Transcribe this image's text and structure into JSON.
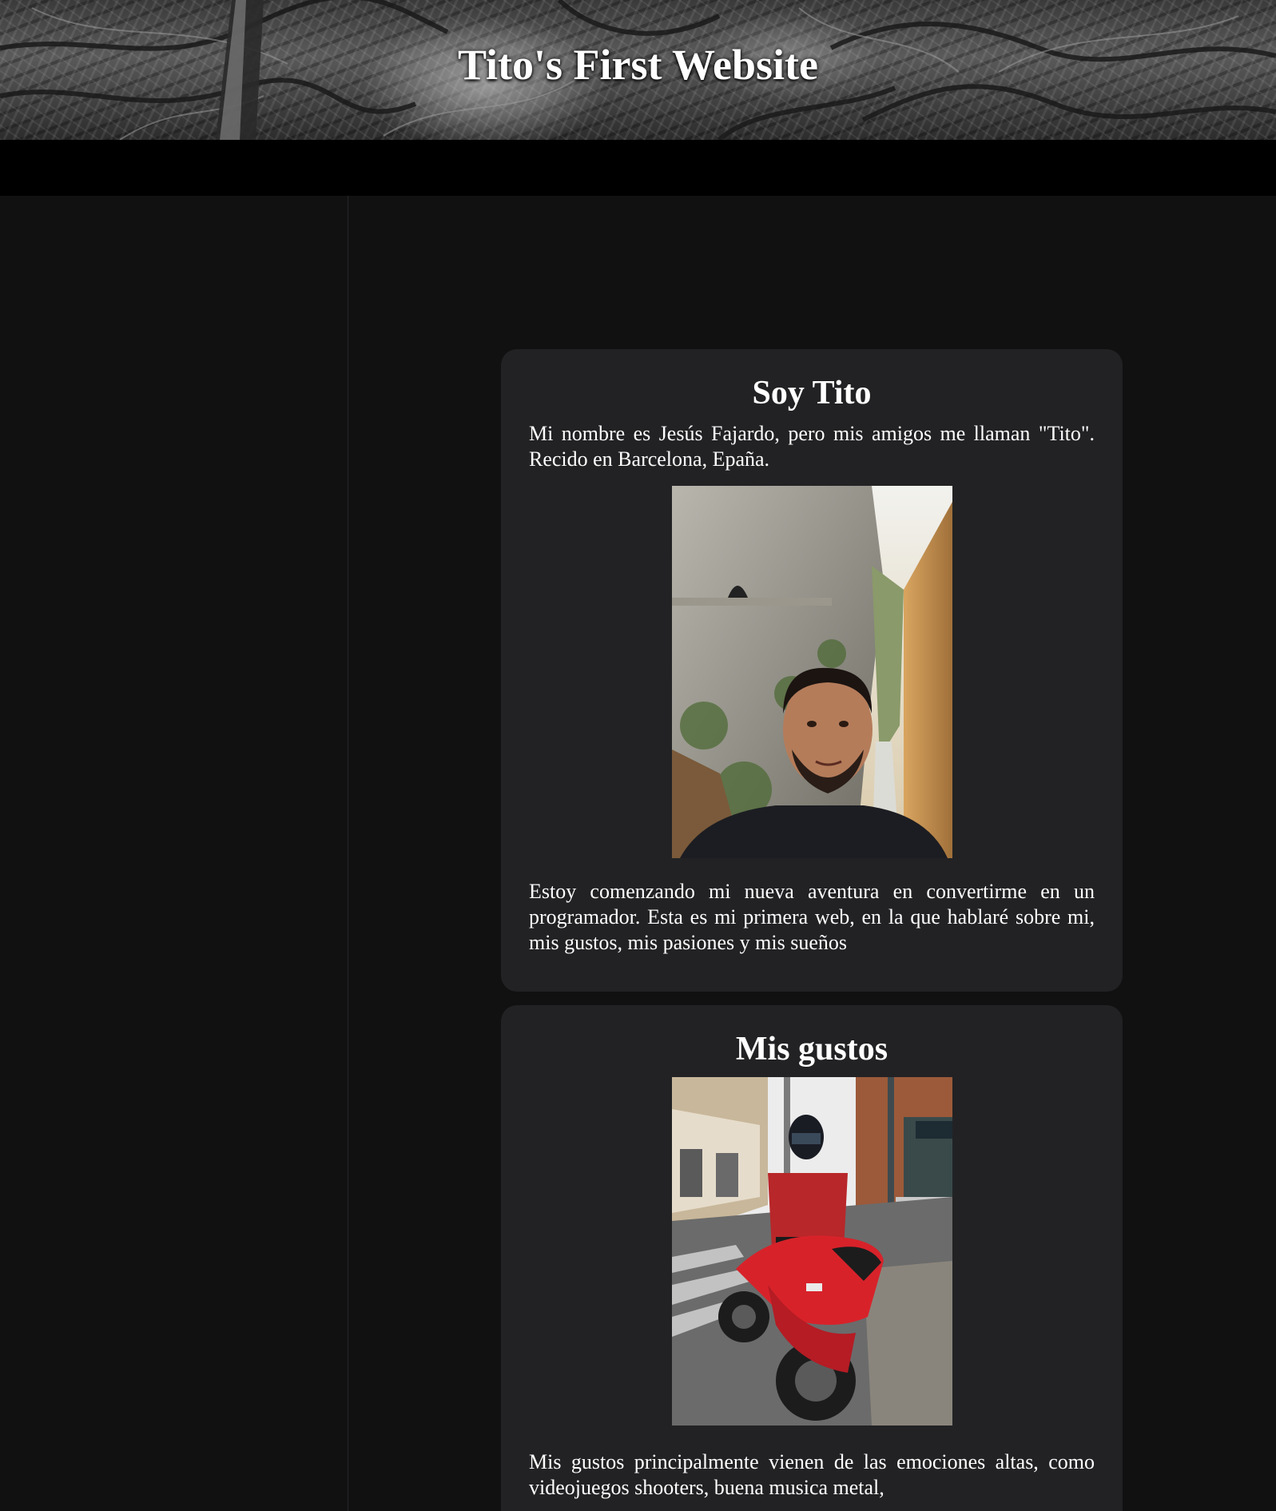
{
  "header": {
    "title": "Tito's First Website"
  },
  "sections": [
    {
      "heading": "Soy Tito",
      "intro": "Mi nombre es Jesús Fajardo, pero mis amigos me llaman \"Tito\". Recido en Barcelona, Epaña.",
      "photo": "selfie-canyon-photo",
      "body": "Estoy comenzando mi nueva aventura en convertirme en un programador. Esta es mi primera web, en la que hablaré sobre mi, mis gustos, mis pasiones y mis sueños"
    },
    {
      "heading": "Mis gustos",
      "photo": "motorcycle-photo",
      "body": "Mis gustos principalmente vienen de las emociones altas, como videojuegos shooters, buena musica metal,"
    }
  ],
  "colors": {
    "page_background": "#111112",
    "navbar": "#000000",
    "card": "#222224",
    "text": "#ffffff"
  }
}
